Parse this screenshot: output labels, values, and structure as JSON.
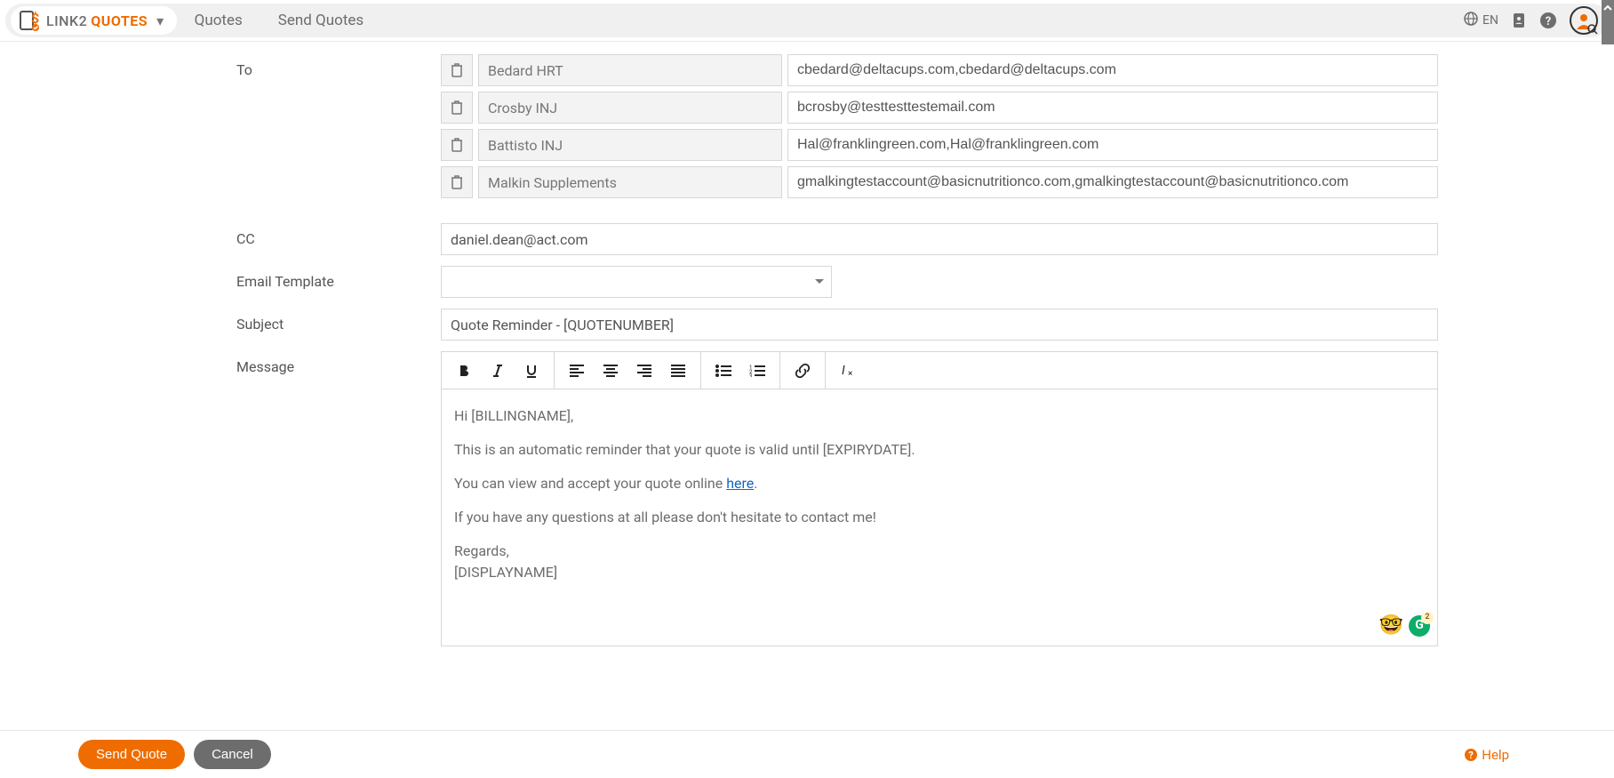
{
  "brand": {
    "part1": "LINK2",
    "part2": "QUOTES"
  },
  "breadcrumbs": [
    "Quotes",
    "Send Quotes"
  ],
  "lang": "EN",
  "labels": {
    "to": "To",
    "cc": "CC",
    "template": "Email Template",
    "subject": "Subject",
    "message": "Message"
  },
  "recipients": [
    {
      "name": "Bedard HRT",
      "email": "cbedard@deltacups.com,cbedard@deltacups.com"
    },
    {
      "name": "Crosby INJ",
      "email": "bcrosby@testtesttestemail.com"
    },
    {
      "name": "Battisto INJ",
      "email": "Hal@franklingreen.com,Hal@franklingreen.com"
    },
    {
      "name": "Malkin Supplements",
      "email": "gmalkingtestaccount@basicnutritionco.com,gmalkingtestaccount@basicnutritionco.com"
    }
  ],
  "cc": "daniel.dean@act.com",
  "template_selected": "",
  "subject": "Quote Reminder - [QUOTENUMBER]",
  "body": {
    "greeting": "Hi [BILLINGNAME],",
    "line1": "This is an automatic reminder that your quote is valid until [EXPIRYDATE].",
    "line2_pre": "You can view and accept your quote online ",
    "line2_link": "here",
    "line2_post": ".",
    "line3": "If you have any questions at all please don't hesitate to contact me!",
    "signoff": "Regards,",
    "displayname": "[DISPLAYNAME]"
  },
  "grammarly_count": "2",
  "buttons": {
    "send": "Send Quote",
    "cancel": "Cancel",
    "help": "Help"
  }
}
